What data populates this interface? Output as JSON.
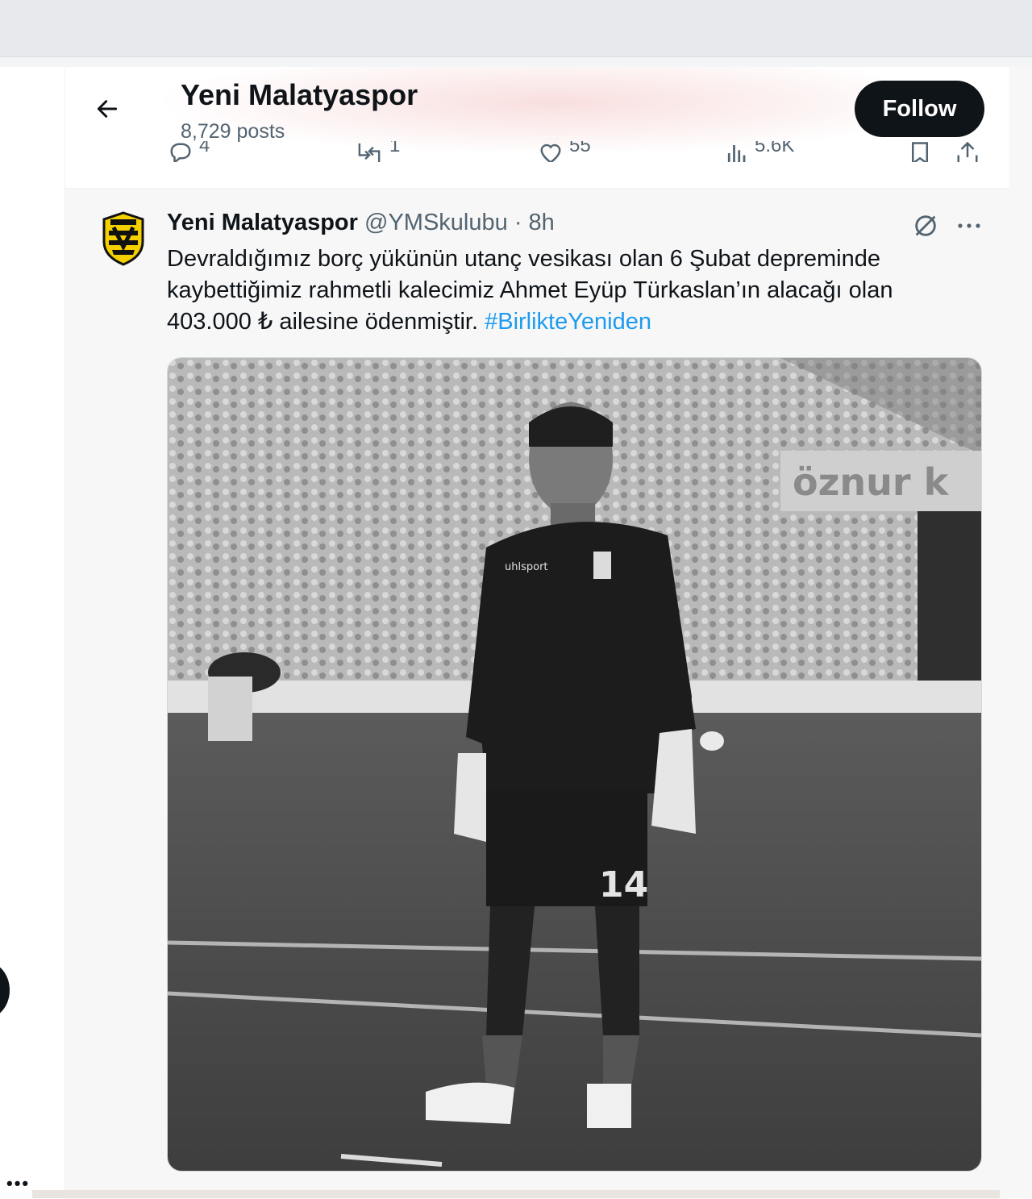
{
  "header": {
    "title": "Yeni Malatyaspor",
    "posts_count": "8,729 posts",
    "follow_label": "Follow"
  },
  "previous_post_actions": {
    "replies": "4",
    "reposts": "1",
    "likes": "55",
    "views": "5.6K"
  },
  "tweet": {
    "display_name": "Yeni Malatyaspor",
    "handle": "@YMSkulubu",
    "separator": "·",
    "time": "8h",
    "text_line1": "Devraldığımız borç yükünün utanç vesikası olan 6 Şubat depreminde",
    "text_line2": "kaybettiğimiz rahmetli kalecimiz Ahmet Eyüp Türkaslan’ın alacağı olan",
    "text_line3": "403.000 ₺ ailesine ödenmiştir.",
    "hashtag": "#BirlikteYeniden",
    "media": {
      "banner_text": "öznur k",
      "shirt_brand": "uhlsport",
      "shirt_number": "14"
    }
  },
  "sidebar": {
    "more_label": "•••"
  },
  "colors": {
    "accent": "#1d9bf0",
    "text_primary": "#0f1419",
    "text_secondary": "#536471",
    "button_dark": "#0f1419",
    "club_yellow": "#f4d000"
  },
  "icons": [
    "back-arrow-icon",
    "reply-icon",
    "repost-icon",
    "like-icon",
    "views-icon",
    "bookmark-icon",
    "share-icon",
    "grok-icon",
    "more-icon"
  ]
}
